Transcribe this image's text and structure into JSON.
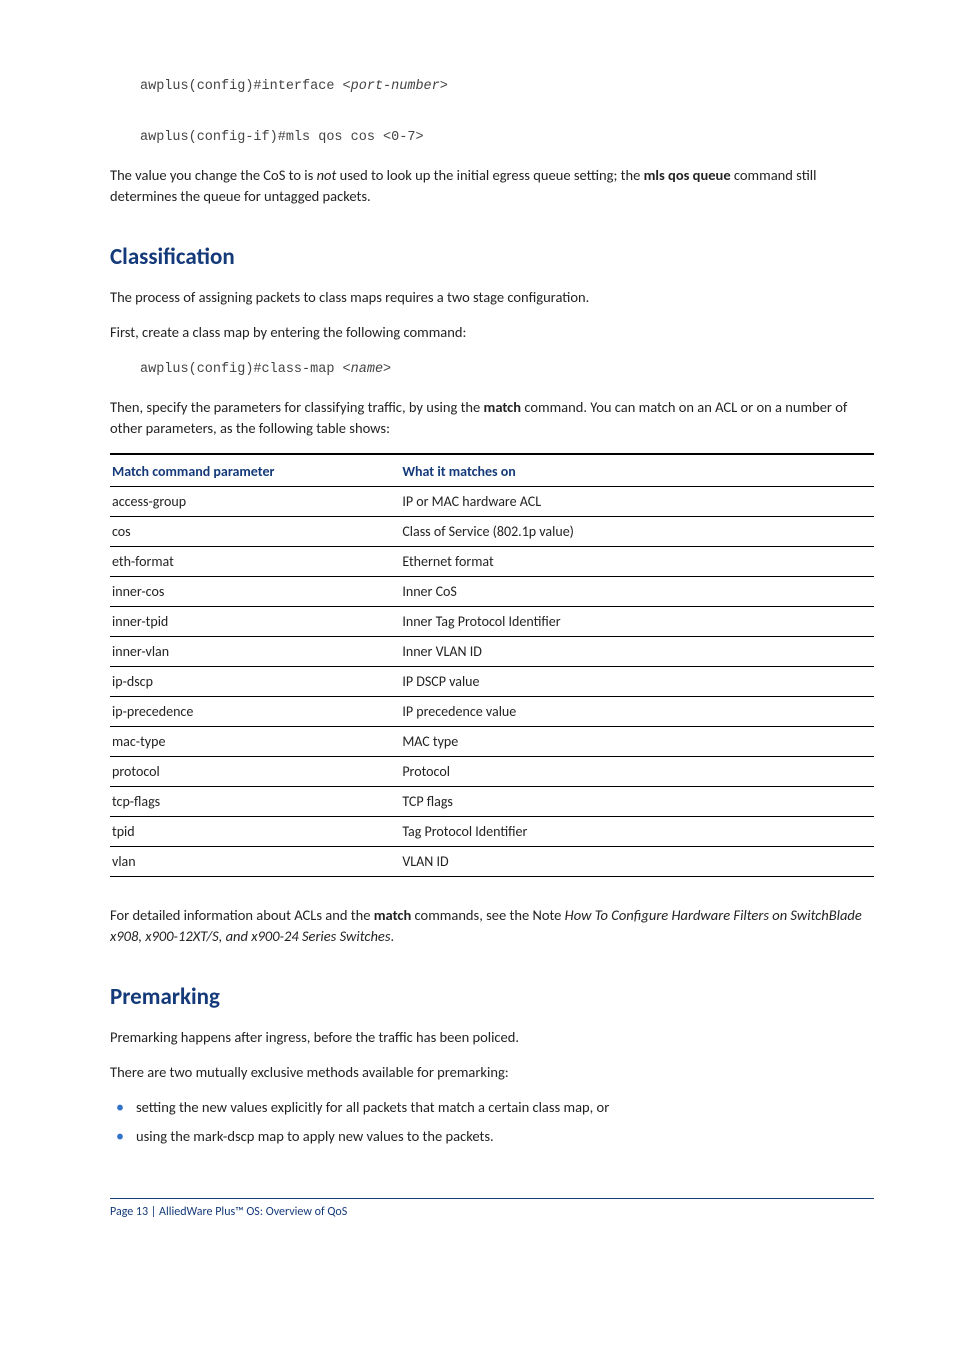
{
  "code": {
    "line1_pre": "awplus(config)#interface <",
    "line1_arg": "port-number",
    "line1_post": ">",
    "line2": "awplus(config-if)#mls qos cos <0-7>",
    "line3_pre": "awplus(config)#class-map <",
    "line3_arg": "name",
    "line3_post": ">"
  },
  "para1a": "The value you change the CoS to is ",
  "para1_not": "not",
  "para1b": " used to look up the initial egress queue setting; the ",
  "para1_cmd": "mls qos queue",
  "para1c": " command still determines the queue for untagged packets.",
  "h_classification": "Classification",
  "para2": "The process of assigning packets to class maps requires a two stage configuration.",
  "para3": "First, create a class map by entering the following command:",
  "para4a": "Then, specify the parameters for classifying traffic, by using the ",
  "para4_cmd": "match",
  "para4b": " command. You can match on an ACL or on a number of other parameters, as the following table shows:",
  "table": {
    "head1": "Match command parameter",
    "head2": "What it matches on",
    "rows": [
      {
        "c1": "access-group",
        "c2": "IP or MAC hardware ACL"
      },
      {
        "c1": "cos",
        "c2": "Class of Service (802.1p value)"
      },
      {
        "c1": "eth-format",
        "c2": "Ethernet format"
      },
      {
        "c1": "inner-cos",
        "c2": "Inner CoS"
      },
      {
        "c1": "inner-tpid",
        "c2": "Inner Tag Protocol Identifier"
      },
      {
        "c1": "inner-vlan",
        "c2": "Inner VLAN ID"
      },
      {
        "c1": "ip-dscp",
        "c2": "IP DSCP value"
      },
      {
        "c1": "ip-precedence",
        "c2": "IP precedence value"
      },
      {
        "c1": "mac-type",
        "c2": "MAC type"
      },
      {
        "c1": "protocol",
        "c2": "Protocol"
      },
      {
        "c1": "tcp-flags",
        "c2": "TCP flags"
      },
      {
        "c1": "tpid",
        "c2": "Tag Protocol Identifier"
      },
      {
        "c1": "vlan",
        "c2": "VLAN ID"
      }
    ]
  },
  "para5a": "For detailed information about ACLs and the ",
  "para5_cmd": "match",
  "para5b": " commands, see the Note ",
  "para5_title": "How To Configure Hardware Filters on SwitchBlade x908, x900-12XT/S, and x900-24 Series Switches",
  "para5c": ".",
  "h_premarking": "Premarking",
  "para6": "Premarking happens after ingress, before the traffic has been policed.",
  "para7": "There are two mutually exclusive methods available for premarking:",
  "bullets": [
    "setting the new values explicitly for all packets that match a certain class map, or",
    "using the mark-dscp map to apply new values to the packets."
  ],
  "footer": "Page 13 | AlliedWare Plus™ OS: Overview of QoS"
}
